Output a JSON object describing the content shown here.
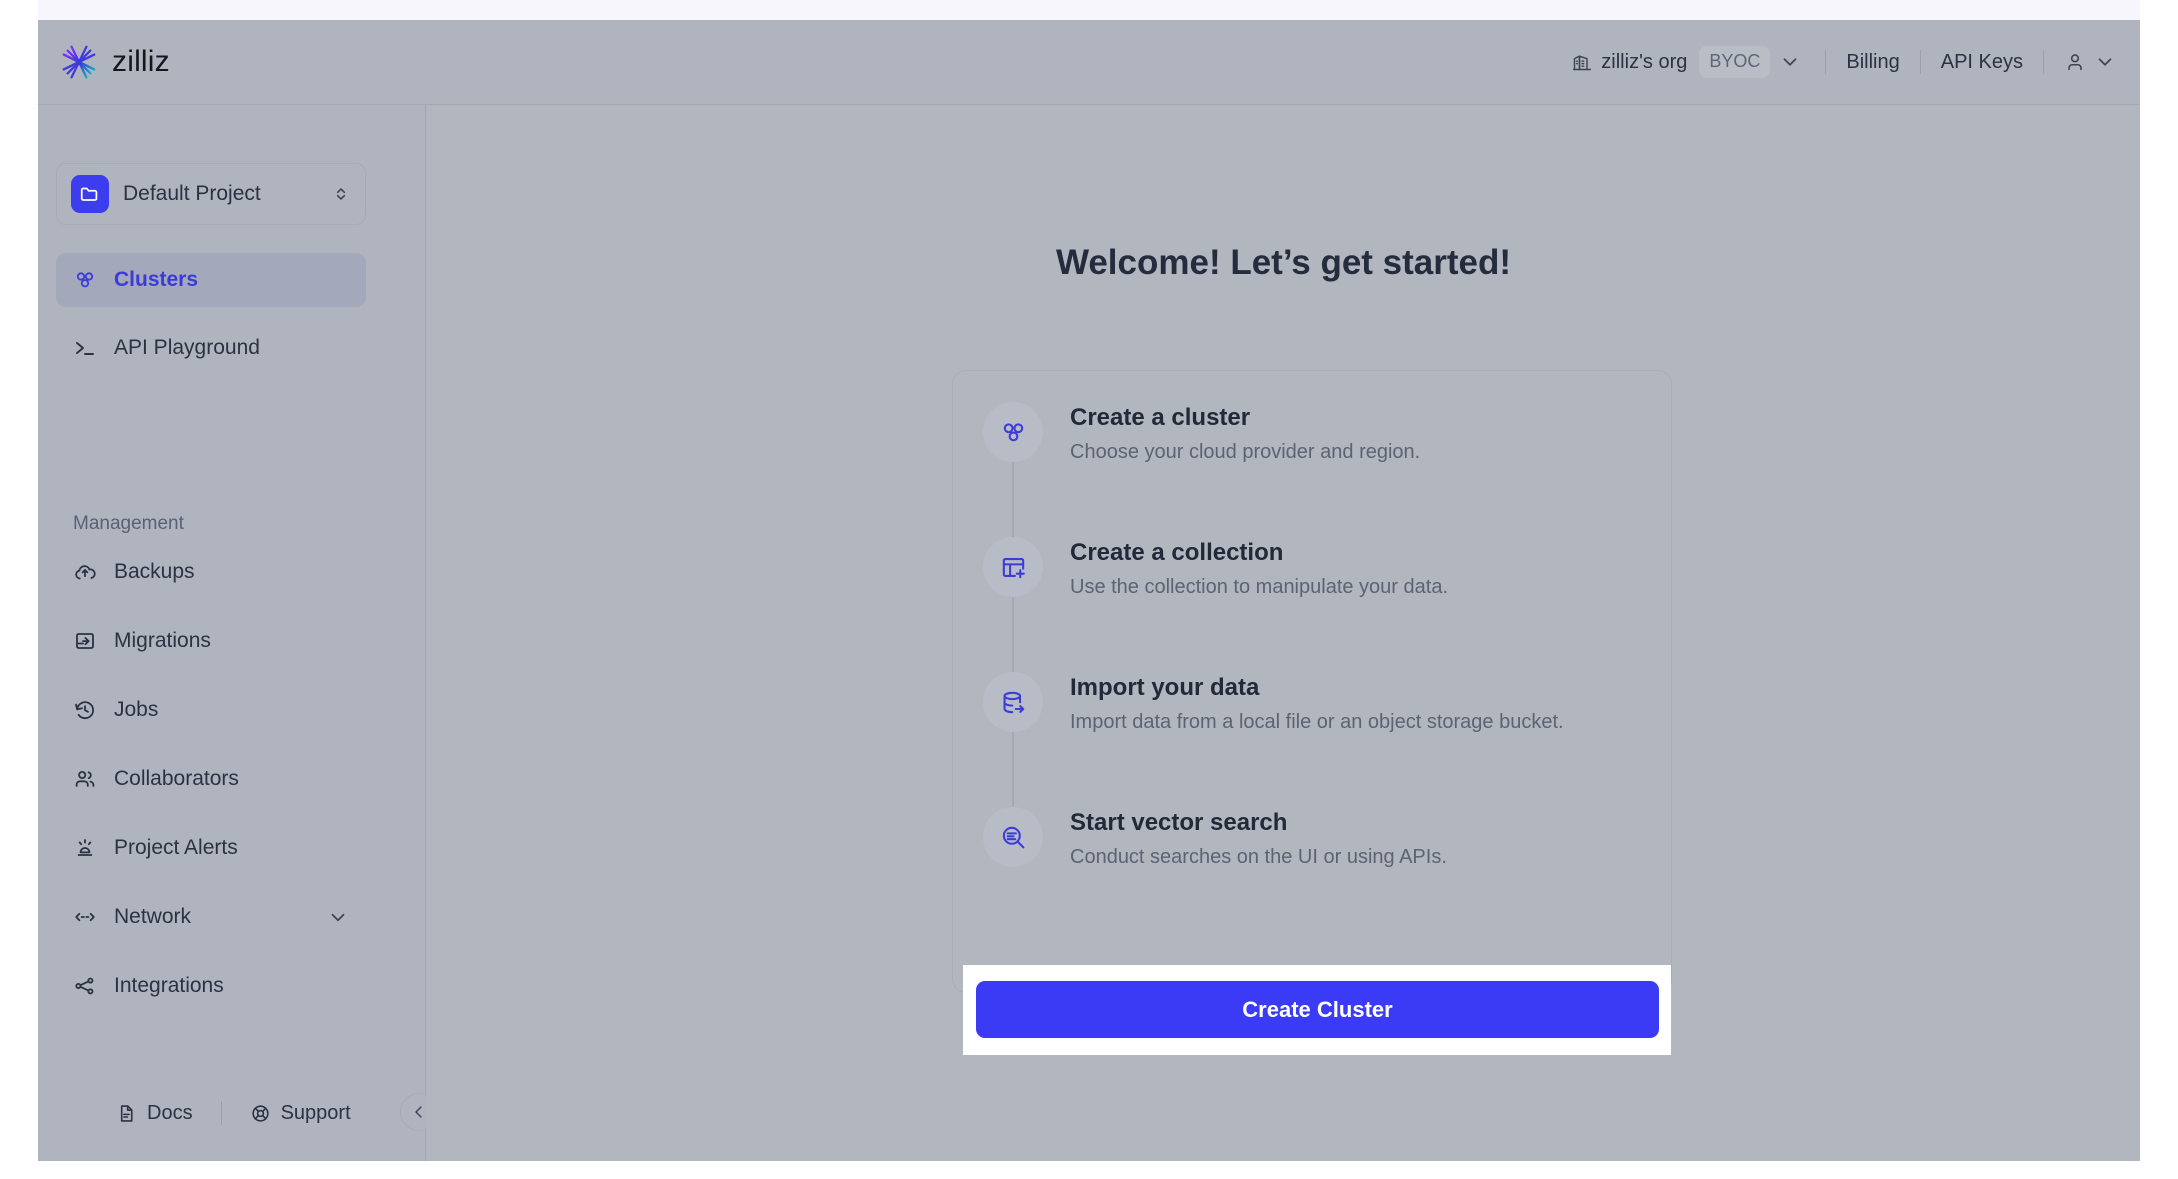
{
  "brand": {
    "name": "zilliz",
    "logo_icon": "zilliz-star-logo"
  },
  "topnav": {
    "org_icon": "building-icon",
    "org_name": "zilliz's org",
    "org_badge": "BYOC",
    "org_chevron_icon": "chevron-down-icon",
    "billing_label": "Billing",
    "api_keys_label": "API Keys",
    "user_icon": "user-icon",
    "user_chevron_icon": "chevron-down-icon"
  },
  "sidebar": {
    "project": {
      "icon": "folder-icon",
      "name": "Default Project",
      "stepper_icon": "chevron-up-down-icon"
    },
    "primary_items": [
      {
        "label": "Clusters",
        "icon": "clusters-icon",
        "active": true
      },
      {
        "label": "API Playground",
        "icon": "terminal-icon",
        "active": false
      }
    ],
    "section_label": "Management",
    "management_items": [
      {
        "label": "Backups",
        "icon": "cloud-upload-icon",
        "expandable": false
      },
      {
        "label": "Migrations",
        "icon": "migrations-icon",
        "expandable": false
      },
      {
        "label": "Jobs",
        "icon": "clock-rewind-icon",
        "expandable": false
      },
      {
        "label": "Collaborators",
        "icon": "users-icon",
        "expandable": false
      },
      {
        "label": "Project Alerts",
        "icon": "siren-icon",
        "expandable": false
      },
      {
        "label": "Network",
        "icon": "network-arrows-icon",
        "expandable": true,
        "chevron_icon": "chevron-down-icon"
      },
      {
        "label": "Integrations",
        "icon": "share-nodes-icon",
        "expandable": false
      }
    ],
    "footer": {
      "docs_label": "Docs",
      "docs_icon": "document-icon",
      "support_label": "Support",
      "support_icon": "lifebuoy-icon",
      "collapse_icon": "chevron-left-icon"
    }
  },
  "main": {
    "title": "Welcome! Let’s get started!",
    "steps": [
      {
        "icon": "clusters-icon",
        "title": "Create a cluster",
        "desc": "Choose your cloud provider and region."
      },
      {
        "icon": "table-plus-icon",
        "title": "Create a collection",
        "desc": "Use the collection to manipulate your data."
      },
      {
        "icon": "database-import-icon",
        "title": "Import your data",
        "desc": "Import data from a local file or an object storage bucket."
      },
      {
        "icon": "search-vector-icon",
        "title": "Start vector search",
        "desc": "Conduct searches on the UI or using APIs."
      }
    ],
    "cta_label": "Create Cluster"
  },
  "colors": {
    "accent": "#3b3bf5",
    "active_nav_text": "#3b3bdb",
    "app_surface": "#b0b4be",
    "main_surface": "#b2b6bf",
    "heading": "#242c3d",
    "muted_text": "#5c6373"
  }
}
